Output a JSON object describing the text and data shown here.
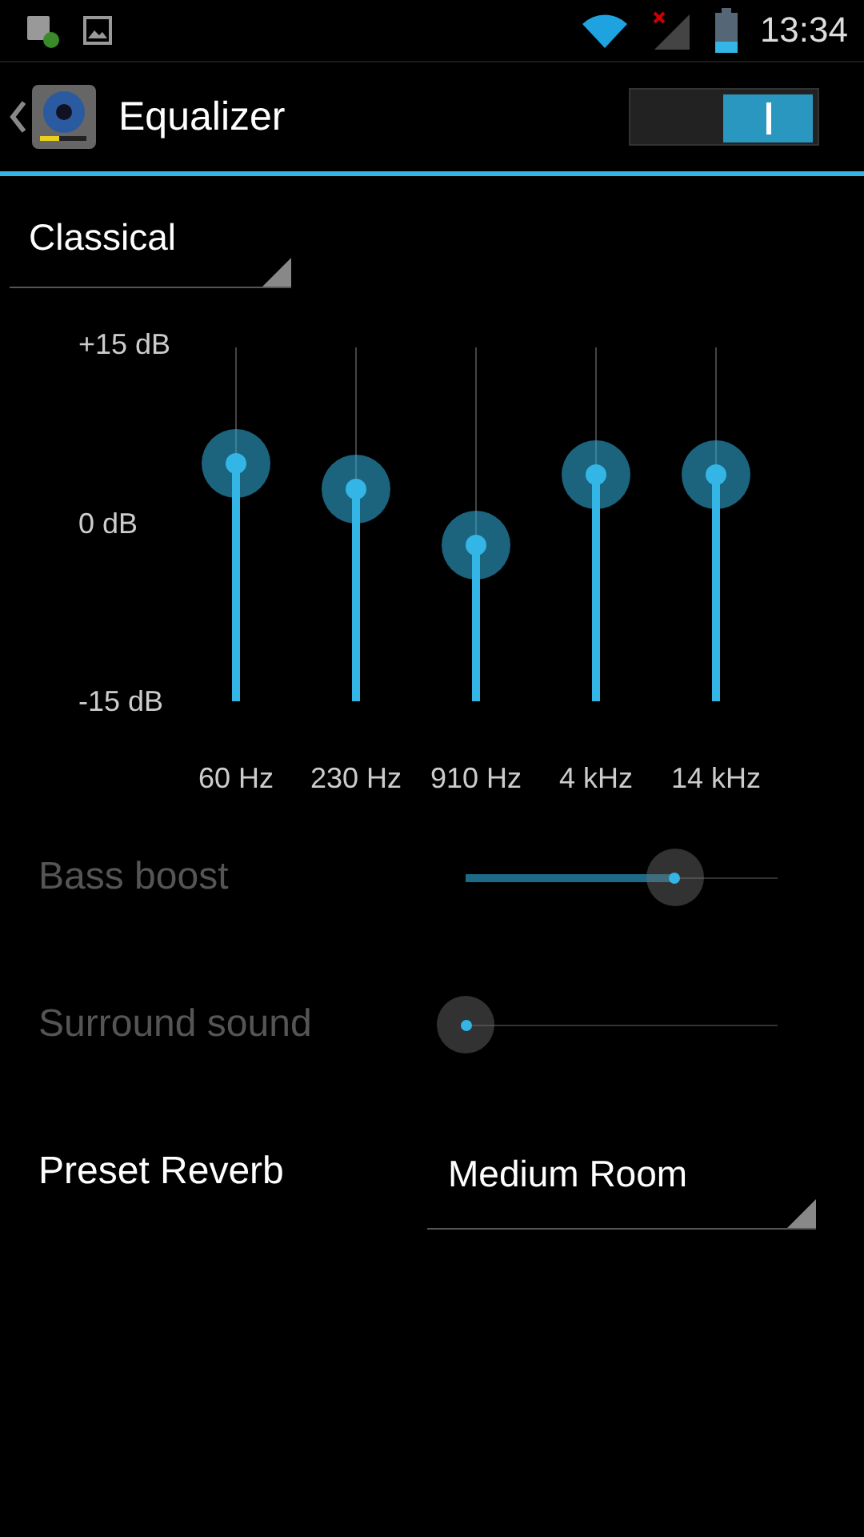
{
  "status_bar": {
    "time": "13:34"
  },
  "action_bar": {
    "title": "Equalizer",
    "on": true
  },
  "preset": {
    "value": "Classical"
  },
  "equalizer": {
    "scale": [
      "+15 dB",
      "0 dB",
      "-15 dB"
    ],
    "bands": [
      {
        "label": "60 Hz",
        "level": 0.67
      },
      {
        "label": "230 Hz",
        "level": 0.6
      },
      {
        "label": "910 Hz",
        "level": 0.44
      },
      {
        "label": "4 kHz",
        "level": 0.64
      },
      {
        "label": "14 kHz",
        "level": 0.64
      }
    ]
  },
  "effects": [
    {
      "label": "Bass boost",
      "level": 0.67,
      "disabled": true
    },
    {
      "label": "Surround sound",
      "disabled": true
    }
  ],
  "reverb": {
    "label": "Preset Reverb",
    "value": "Medium Room"
  }
}
